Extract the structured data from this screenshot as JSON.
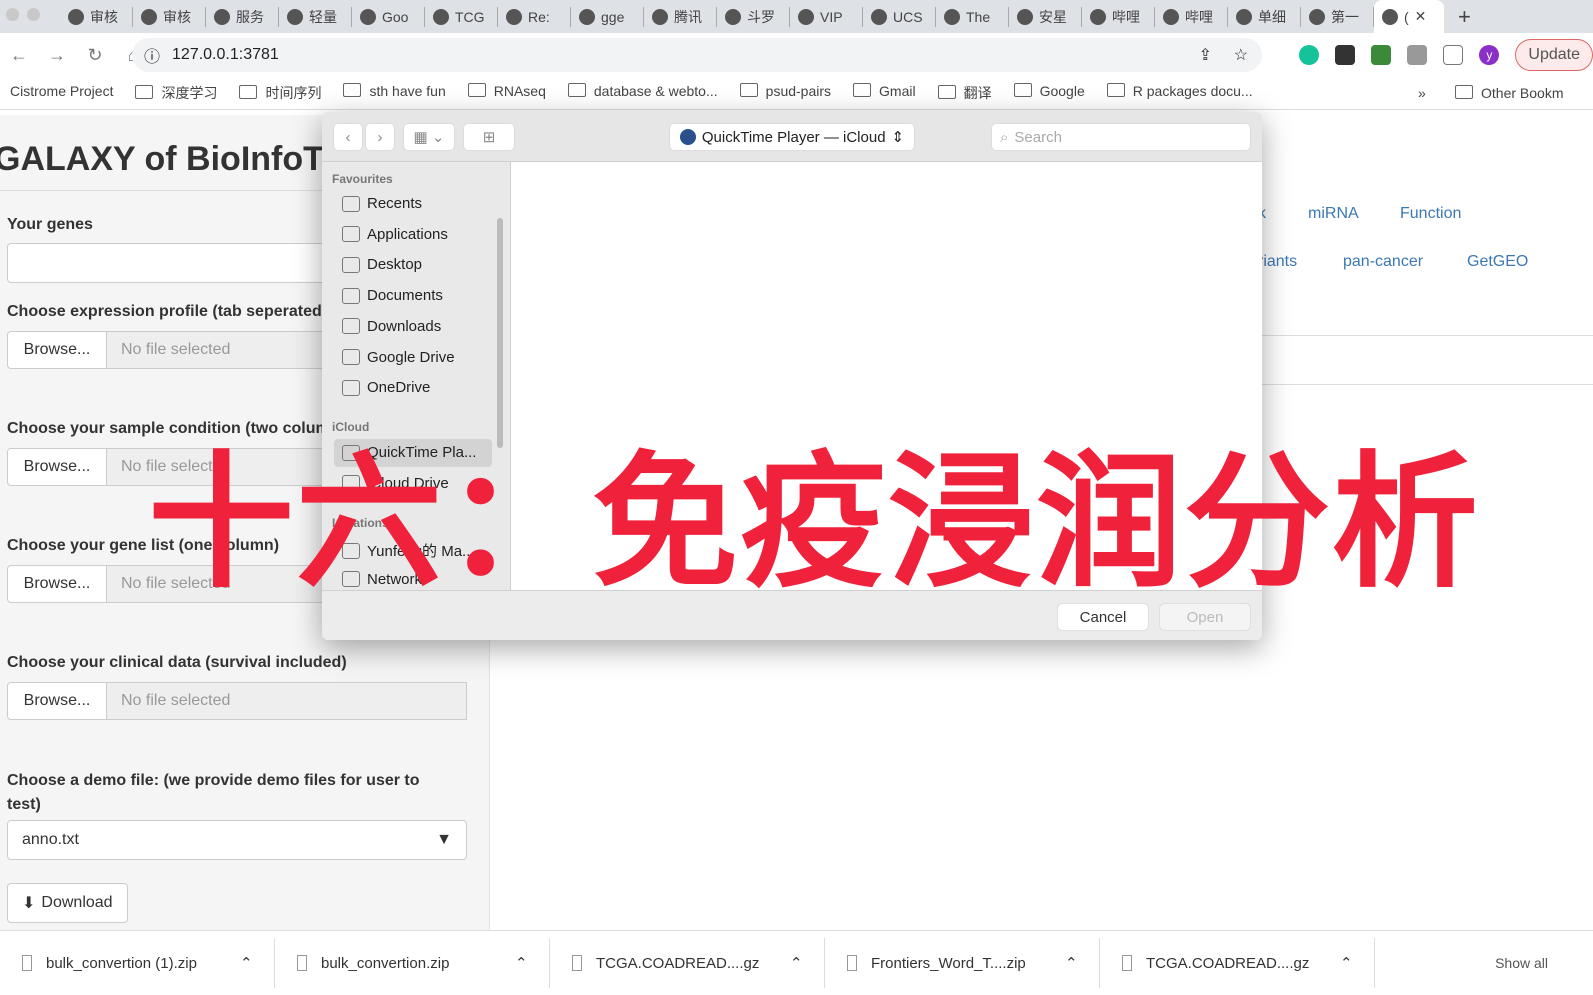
{
  "browser": {
    "tabs": [
      "审核",
      "审核",
      "服务",
      "轻量",
      "Goo",
      "TCG",
      "Re:",
      "gge",
      "腾讯",
      "斗罗",
      "VIP",
      "UCS",
      "The",
      "安星",
      "哔哩",
      "哔哩",
      "单细",
      "第一",
      "("
    ],
    "url": "127.0.0.1:3781",
    "update_label": "Update",
    "profile_initial": "y",
    "bookmarks": [
      "Cistrome Project",
      "深度学习",
      "时间序列",
      "sth have fun",
      "RNAseq",
      "database & webto...",
      "psud-pairs",
      "Gmail",
      "翻译",
      "Google",
      "R packages docu..."
    ],
    "bookmarks_more": "»",
    "other_bookmarks": "Other Bookm"
  },
  "page": {
    "title": "GALAXY of BioInfoTools",
    "your_genes_label": "Your genes",
    "fields": [
      {
        "label": "Choose expression profile (tab seperated)",
        "browse": "Browse...",
        "status": "No file selected"
      },
      {
        "label": "Choose your sample condition (two columns)",
        "browse": "Browse...",
        "status": "No file selected"
      },
      {
        "label": "Choose your gene list (one column)",
        "browse": "Browse...",
        "status": "No file selected"
      },
      {
        "label": "Choose your clinical data (survival included)",
        "browse": "Browse...",
        "status": "No file selected"
      }
    ],
    "demo_label": "Choose a demo file: (we provide demo files for user to test)",
    "demo_selected": "anno.txt",
    "download_label": "Download",
    "nav_row1": [
      "k",
      "miRNA",
      "Function"
    ],
    "nav_row2": [
      "riants",
      "pan-cancer",
      "GetGEO"
    ],
    "link_color": "#3c78b4"
  },
  "dialog": {
    "location": "QuickTime Player — iCloud",
    "search_placeholder": "Search",
    "sections": {
      "favourites": "Favourites",
      "icloud": "iCloud",
      "locations": "Locations"
    },
    "favourites": [
      "Recents",
      "Applications",
      "Desktop",
      "Documents",
      "Downloads",
      "Google Drive",
      "OneDrive"
    ],
    "icloud": [
      "QuickTime Pla...",
      "iCloud Drive"
    ],
    "locations": [
      "Yunfeng的 Ma...",
      "Network"
    ],
    "cancel": "Cancel",
    "open": "Open"
  },
  "overlay_text": "十六：免疫浸润分析",
  "overlay_color": "#f0213a",
  "downloads": {
    "items": [
      "bulk_convertion (1).zip",
      "bulk_convertion.zip",
      "TCGA.COADREAD....gz",
      "Frontiers_Word_T....zip",
      "TCGA.COADREAD....gz"
    ],
    "show_all": "Show all"
  }
}
